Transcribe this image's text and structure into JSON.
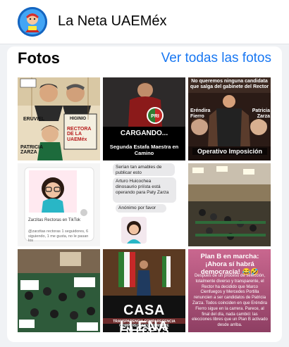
{
  "header": {
    "page_name": "La Neta UAEMéx"
  },
  "photos": {
    "title": "Fotos",
    "see_all": "Ver todas las fotos",
    "tiles": [
      {
        "caption_name_1": "ERUVIEL",
        "caption_name_2": "HIGINIO",
        "caption_center": "PATRICIA ZARZA",
        "caption": "RECTORA DE LA UAEMéx"
      },
      {
        "title": "CARGANDO...",
        "subtitle": "Segunda Estafa Maestra en Camino"
      },
      {
        "top": "No queremos ninguna candidata que salga del gabinete del Rector",
        "left": "Eréndira Fierro",
        "right": "Patricia Zarza",
        "bottom": "Operativo Imposición"
      },
      {
        "title": "Zarzitas Rectoras en TikTok",
        "subtitle": "@zarzitas rectoras 1 seguidores, 6 siguiendo, 1 me gusta, no le pasan los"
      },
      {
        "msg1": "Serían tan amables de publicar esto",
        "msg2": "Arturo Huicochea dinosaurio priísta está operando para Paty Zarza",
        "msg3": "Anónimo por favor"
      },
      {},
      {},
      {
        "title": "CASA LLENA",
        "band": "TRANSPARENCIA COMPARECENCIA COMPARECENCIA COMPARE",
        "title2": "EN FCPYS"
      },
      {
        "title": "Plan B en marcha: ¡Ahora sí habrá democracia! 😂🤣",
        "body": "Después de un proceso de selección, totalmente diverso y transparente, el Rector ha decidido que Marco Cienfuegos y Mercedes Portilla renuncien a ser candidatos de Patricia Zarza. Todos coinciden en que Eréndira Fierro sigue en la carrera. Parece, al final del día, nada cambió: las elecciones libres que un Plan B activado desde arriba."
      }
    ]
  },
  "colors": {
    "link": "#1877f2",
    "card_bg": "#ffffff",
    "page_bg": "#f0f2f5"
  }
}
